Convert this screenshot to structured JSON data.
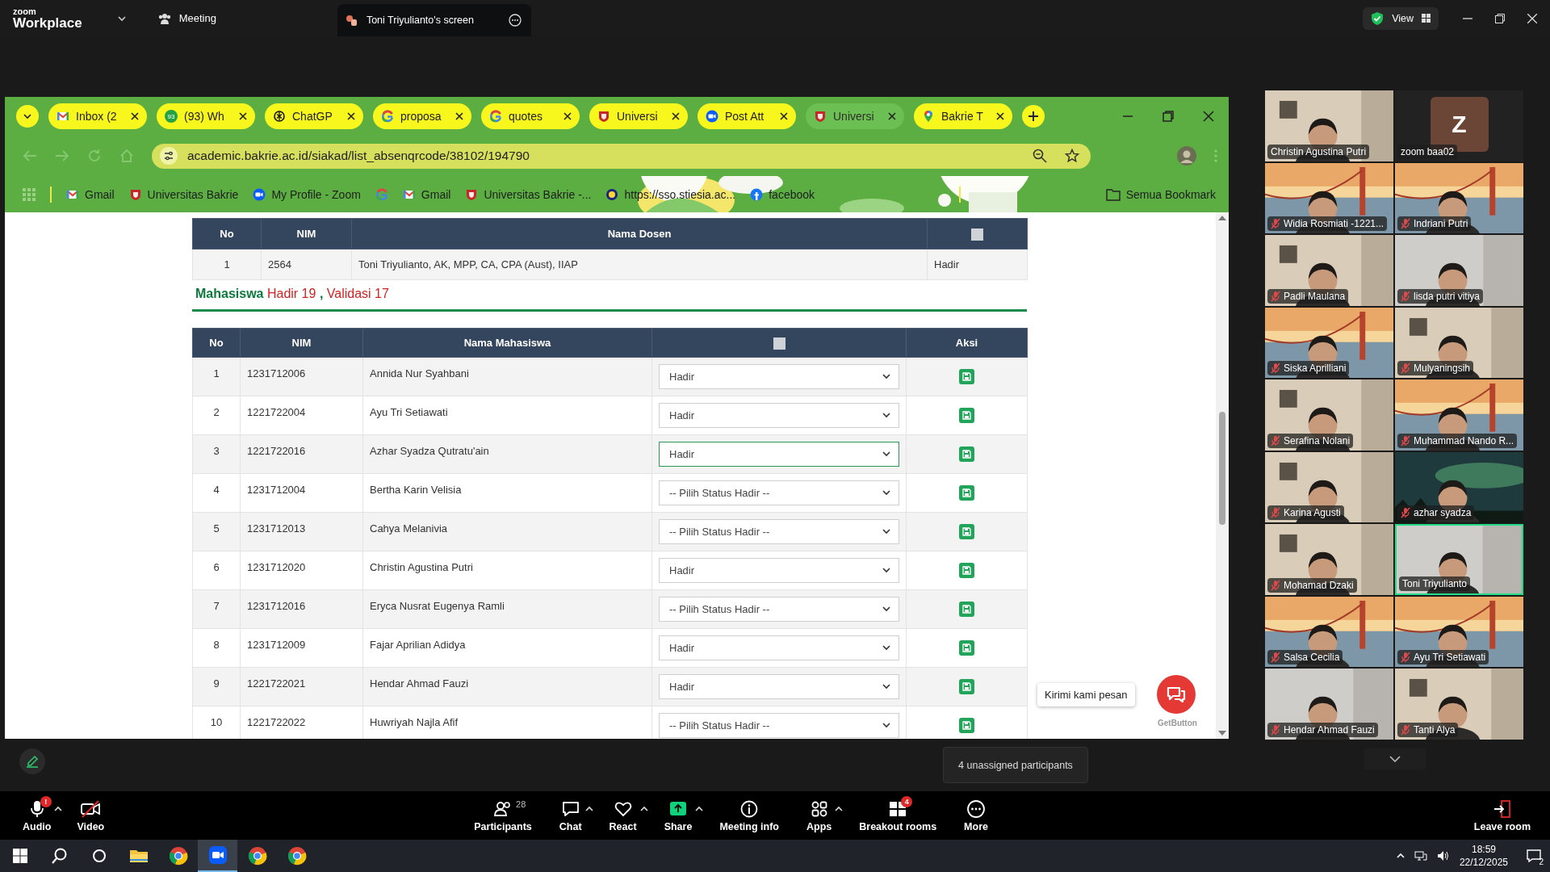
{
  "zoom_bar": {
    "logo_top": "zoom",
    "logo_bottom": "Workplace",
    "meeting": "Meeting",
    "share_tab": "Toni Triyulianto's screen",
    "view": "View"
  },
  "browser": {
    "tabs": [
      {
        "label": "Inbox (2",
        "selected": false
      },
      {
        "label": "(93) Wh",
        "badge": "93",
        "selected": false
      },
      {
        "label": "ChatGP",
        "selected": false
      },
      {
        "label": "proposa",
        "selected": false
      },
      {
        "label": "quotes",
        "selected": false
      },
      {
        "label": "Universi",
        "selected": false
      },
      {
        "label": "Post Att",
        "selected": false
      },
      {
        "label": "Universi",
        "selected": true
      },
      {
        "label": "Bakrie T",
        "selected": false
      }
    ],
    "address": "academic.bakrie.ac.id/siakad/list_absenqrcode/38102/194790",
    "bookmarks": [
      "Gmail",
      "Universitas Bakrie",
      "My Profile - Zoom",
      "Gmail",
      "Universitas Bakrie -...",
      "https://sso.stiesia.ac...",
      "facebook"
    ],
    "bookmarks_folder": "Semua Bookmark"
  },
  "page": {
    "lecturer_table": {
      "columns": [
        "No",
        "NIM",
        "Nama Dosen"
      ],
      "select_all_checked": false,
      "rows": [
        {
          "no": "1",
          "nim": "2564",
          "name": "Toni Triyulianto, AK, MPP, CA, CPA (Aust), IIAP",
          "status": "Hadir"
        }
      ]
    },
    "summary": {
      "label": "Mahasiswa",
      "present": "Hadir  19",
      "separator": ",",
      "validated": "Validasi  17"
    },
    "student_table": {
      "columns": [
        "No",
        "NIM",
        "Nama Mahasiswa",
        "Aksi"
      ],
      "select_all_checked": false,
      "rows": [
        {
          "no": "1",
          "nim": "1231712006",
          "name": "Annida Nur Syahbani",
          "status": "Hadir",
          "focused": false
        },
        {
          "no": "2",
          "nim": "1221722004",
          "name": "Ayu Tri Setiawati",
          "status": "Hadir",
          "focused": false
        },
        {
          "no": "3",
          "nim": "1221722016",
          "name": "Azhar Syadza Qutratu'ain",
          "status": "Hadir",
          "focused": true
        },
        {
          "no": "4",
          "nim": "1231712004",
          "name": "Bertha Karin Velisia",
          "status": "-- Pilih Status Hadir --",
          "focused": false
        },
        {
          "no": "5",
          "nim": "1231712013",
          "name": "Cahya Melanivia",
          "status": "-- Pilih Status Hadir --",
          "focused": false
        },
        {
          "no": "6",
          "nim": "1231712020",
          "name": "Christin Agustina Putri",
          "status": "Hadir",
          "focused": false
        },
        {
          "no": "7",
          "nim": "1231712016",
          "name": "Eryca Nusrat Eugenya Ramli",
          "status": "-- Pilih Status Hadir --",
          "focused": false
        },
        {
          "no": "8",
          "nim": "1231712009",
          "name": "Fajar Aprilian Adidya",
          "status": "Hadir",
          "focused": false
        },
        {
          "no": "9",
          "nim": "1221722021",
          "name": "Hendar Ahmad Fauzi",
          "status": "Hadir",
          "focused": false
        },
        {
          "no": "10",
          "nim": "1221722022",
          "name": "Huwriyah Najla Afif",
          "status": "-- Pilih Status Hadir --",
          "focused": false
        }
      ]
    },
    "chat_widget": {
      "label": "Kirimi kami pesan",
      "brand": "GetButton"
    }
  },
  "gallery": [
    {
      "name": "Christin Agustina Putri",
      "kind": "video",
      "muted": false,
      "active_speaker": false
    },
    {
      "name": "zoom baa02",
      "kind": "avatar",
      "initial": "Z",
      "muted": false,
      "active_speaker": false
    },
    {
      "name": "Widia Rosmiati -1221...",
      "kind": "video",
      "muted": true,
      "active_speaker": false
    },
    {
      "name": "Indriani Putri",
      "kind": "video",
      "muted": true,
      "active_speaker": false
    },
    {
      "name": "Padli Maulana",
      "kind": "video",
      "muted": true,
      "active_speaker": false
    },
    {
      "name": "lisda putri vitiya",
      "kind": "video",
      "muted": true,
      "active_speaker": false
    },
    {
      "name": "Siska Aprilliani",
      "kind": "video",
      "muted": true,
      "active_speaker": false
    },
    {
      "name": "Mulyaningsih",
      "kind": "video",
      "muted": true,
      "active_speaker": false
    },
    {
      "name": "Serafina Nolani",
      "kind": "video",
      "muted": true,
      "active_speaker": false
    },
    {
      "name": "Muhammad Nando R...",
      "kind": "video",
      "muted": true,
      "active_speaker": false
    },
    {
      "name": "Karina Agusti",
      "kind": "video",
      "muted": true,
      "active_speaker": false
    },
    {
      "name": "azhar syadza",
      "kind": "video",
      "muted": true,
      "active_speaker": false
    },
    {
      "name": "Mohamad Dzaki",
      "kind": "video",
      "muted": true,
      "active_speaker": false
    },
    {
      "name": "Toni Triyulianto",
      "kind": "video",
      "muted": false,
      "active_speaker": true
    },
    {
      "name": "Salsa Cecilia",
      "kind": "video",
      "muted": true,
      "active_speaker": false
    },
    {
      "name": "Ayu Tri Setiawati",
      "kind": "video",
      "muted": true,
      "active_speaker": false
    },
    {
      "name": "Hendar Ahmad Fauzi",
      "kind": "video",
      "muted": true,
      "active_speaker": false
    },
    {
      "name": "Tanti Alya",
      "kind": "video",
      "muted": true,
      "active_speaker": false
    }
  ],
  "unassigned_tooltip": "4 unassigned participants",
  "toolbar": {
    "left": [
      {
        "label": "Audio",
        "badge": "!",
        "caret": true,
        "off": false
      },
      {
        "label": "Video",
        "caret": false,
        "off": true
      }
    ],
    "center": [
      {
        "label": "Participants",
        "count": "28",
        "caret": false
      },
      {
        "label": "Chat",
        "caret": true
      },
      {
        "label": "React",
        "caret": true
      },
      {
        "label": "Share",
        "caret": true
      },
      {
        "label": "Meeting info",
        "caret": false
      },
      {
        "label": "Apps",
        "caret": true
      },
      {
        "label": "Breakout rooms",
        "badge": "4",
        "caret": false
      },
      {
        "label": "More",
        "caret": false
      }
    ],
    "leave": "Leave room"
  },
  "taskbar": {
    "apps": [
      {
        "active": false
      },
      {
        "active": false
      },
      {
        "active": false
      },
      {
        "active": false
      },
      {
        "active": false
      },
      {
        "active": true
      },
      {
        "active": false
      },
      {
        "active": false
      }
    ],
    "time": "18:59",
    "date": "22/12/2025",
    "notifications": "2"
  }
}
